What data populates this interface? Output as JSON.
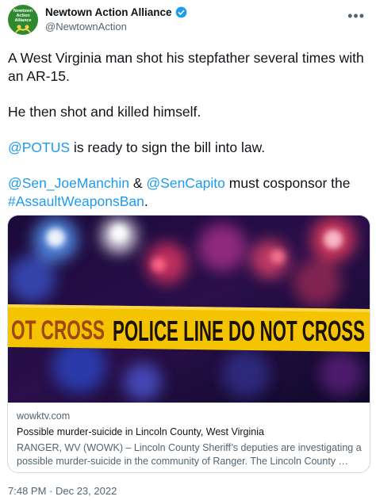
{
  "author": {
    "avatar_text": "Newtown Action Alliance",
    "display_name": "Newtown Action Alliance",
    "handle": "@NewtownAction",
    "verified": true
  },
  "tweet": {
    "line1": "A West Virginia man shot his stepfather several times with an AR-15.",
    "line2": "He then shot and killed himself.",
    "mention_potus": "@POTUS",
    "line3_rest": " is ready to sign the bill into law.",
    "mention_manchin": "@Sen_JoeManchin",
    "amp": " & ",
    "mention_capito": "@SenCapito",
    "line4_rest": " must cosponsor the ",
    "hashtag": "#AssaultWeaponsBan",
    "period": "."
  },
  "card": {
    "tape_text": "POLICE LINE DO NOT CROSS",
    "tape_left_text": "OT CROSS",
    "domain": "wowktv.com",
    "title": "Possible murder-suicide in Lincoln County, West Virginia",
    "description": "RANGER, WV (WOWK) – Lincoln County Sheriff’s deputies are investigating a possible murder-suicide in the community of Ranger.  The Lincoln County …"
  },
  "timestamp": "7:48 PM · Dec 23, 2022",
  "colors": {
    "link": "#1d9bf0",
    "verified": "#1d9bf0",
    "avatar_bg": "#2f8a2f"
  },
  "icons": [
    "verified-badge-icon",
    "more-options-icon"
  ]
}
